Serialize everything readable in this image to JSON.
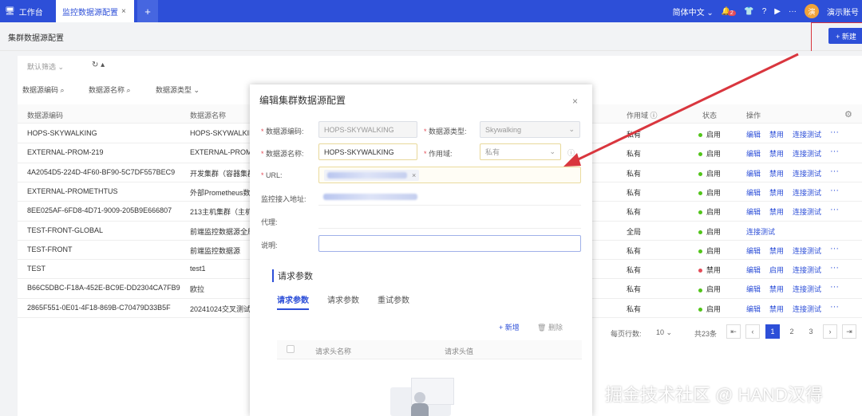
{
  "topbar": {
    "tabs": [
      {
        "label": "工作台"
      },
      {
        "label": "监控数据源配置",
        "close": "×"
      },
      {
        "label": "+"
      }
    ],
    "language": "简体中文",
    "notify_count": "2",
    "more": "···",
    "avatar_char": "演",
    "account": "演示账号"
  },
  "page": {
    "title": "集群数据源配置",
    "new_button": "+ 新建"
  },
  "filters": {
    "default_filter": "默认筛选",
    "code": "数据源编码",
    "name": "数据源名称",
    "type": "数据源类型"
  },
  "table": {
    "headers": {
      "code": "数据源编码",
      "name": "数据源名称",
      "scope": "作用域",
      "status": "状态",
      "action": "操作"
    },
    "rows": [
      {
        "code": "HOPS-SKYWALKING",
        "name": "HOPS-SKYWALKIN",
        "scope": "私有",
        "status": "启用",
        "actions": [
          "编辑",
          "禁用",
          "连接测试"
        ]
      },
      {
        "code": "EXTERNAL-PROM-219",
        "name": "EXTERNAL-PROM",
        "scope": "私有",
        "status": "启用",
        "actions": [
          "编辑",
          "禁用",
          "连接测试"
        ]
      },
      {
        "code": "4A2054D5-224D-4F60-BF90-5C7DF557BEC9",
        "name": "开发集群（容器集群",
        "scope": "私有",
        "status": "启用",
        "actions": [
          "编辑",
          "禁用",
          "连接测试"
        ]
      },
      {
        "code": "EXTERNAL-PROMETHTUS",
        "name": "外部Prometheus数",
        "scope": "私有",
        "status": "启用",
        "actions": [
          "编辑",
          "禁用",
          "连接测试"
        ]
      },
      {
        "code": "8EE025AF-6FD8-4D71-9009-205B9E666807",
        "name": "213主机集群（主机",
        "scope": "私有",
        "status": "启用",
        "actions": [
          "编辑",
          "禁用",
          "连接测试"
        ]
      },
      {
        "code": "TEST-FRONT-GLOBAL",
        "name": "前端监控数据源全局",
        "scope": "全局",
        "status": "启用",
        "actions": [
          "连接测试"
        ]
      },
      {
        "code": "TEST-FRONT",
        "name": "前端监控数据源",
        "scope": "私有",
        "status": "启用",
        "actions": [
          "编辑",
          "禁用",
          "连接测试"
        ]
      },
      {
        "code": "TEST",
        "name": "test1",
        "scope": "私有",
        "status": "禁用",
        "actions": [
          "编辑",
          "启用",
          "连接测试"
        ]
      },
      {
        "code": "B66C5DBC-F18A-452E-BC9E-DD2304CA7FB9",
        "name": "欧拉",
        "scope": "私有",
        "status": "启用",
        "actions": [
          "编辑",
          "禁用",
          "连接测试"
        ]
      },
      {
        "code": "2865F551-0E01-4F18-869B-C70479D33B5F",
        "name": "20241024交叉测试",
        "scope": "私有",
        "status": "启用",
        "actions": [
          "编辑",
          "禁用",
          "连接测试"
        ]
      }
    ],
    "more": "···"
  },
  "pagination": {
    "per_page_label": "每页行数:",
    "per_page": "10",
    "total": "共23条",
    "pages": [
      "1",
      "2",
      "3"
    ],
    "current": "1"
  },
  "modal": {
    "title": "编辑集群数据源配置",
    "close": "×",
    "code_label": "数据源编码:",
    "code_value": "HOPS-SKYWALKING",
    "type_label": "数据源类型:",
    "type_value": "Skywalking",
    "name_label": "数据源名称:",
    "name_value": "HOPS-SKYWALKING",
    "scope_label": "作用域:",
    "scope_value": "私有",
    "url_label": "URL:",
    "monitor_label": "监控接入地址:",
    "proxy_label": "代理:",
    "desc_label": "说明:",
    "section_title": "请求参数",
    "tabs": [
      "请求参数",
      "请求参数",
      "重试参数"
    ],
    "add": "+ 新增",
    "delete": "删除",
    "col_name": "请求头名称",
    "col_value": "请求头值"
  },
  "watermark": "掘金技术社区 @ HAND汉得",
  "colors": {
    "brand": "#2d4fd8",
    "enabled": "#52c41a",
    "disabled": "#e34d59",
    "annotation": "#d9363e"
  }
}
